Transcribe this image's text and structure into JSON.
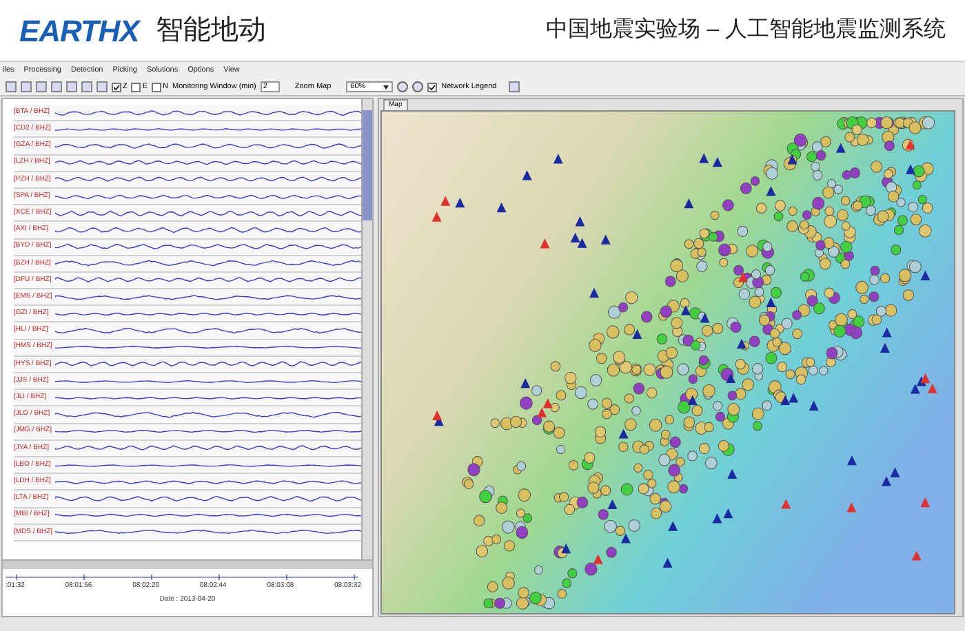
{
  "header": {
    "logo": "EARTHX",
    "product": "智能地动",
    "title": "中国地震实验场 – 人工智能地震监测系统"
  },
  "menu": [
    "iles",
    "Processing",
    "Detection",
    "Picking",
    "Solutions",
    "Options",
    "View"
  ],
  "toolbar": {
    "components": [
      {
        "label": "Z",
        "checked": true
      },
      {
        "label": "E",
        "checked": false
      },
      {
        "label": "N",
        "checked": false
      }
    ],
    "window_label": "Monitoring Window (min)",
    "window_value": "2",
    "zoom_label": "Zoom Map",
    "zoom_value": "60%",
    "legend": {
      "label": "Network Legend",
      "checked": true
    }
  },
  "stations": [
    "[BTA / BHZ]",
    "[CD2 / BHZ]",
    "[GZA / BHZ]",
    "[LZH / BHZ]",
    "[PZH / BHZ]",
    "[SPA / BHZ]",
    "[XCE / BHZ]",
    "[AXI / BHZ]",
    "[BYD / BHZ]",
    "[BZH / BHZ]",
    "[DFU / BHZ]",
    "[EMS / BHZ]",
    "[GZI / BHZ]",
    "[HLI / BHZ]",
    "[HMS / BHZ]",
    "[HYS / BHZ]",
    "[JJS / BHZ]",
    "[JLI / BHZ]",
    "[JLO / BHZ]",
    "[JMG / BHZ]",
    "[JYA / BHZ]",
    "[LBO / BHZ]",
    "[LDH / BHZ]",
    "[LTA / BHZ]",
    "[MBI / BHZ]",
    "[MDS / BHZ]"
  ],
  "time_axis": {
    "ticks": [
      ":01:32",
      "08:01:56",
      "08:02:20",
      "08:02:44",
      "08:03:08",
      "08:03:32"
    ],
    "date": "Date : 2013-04-20"
  },
  "map": {
    "tab": "Map"
  }
}
